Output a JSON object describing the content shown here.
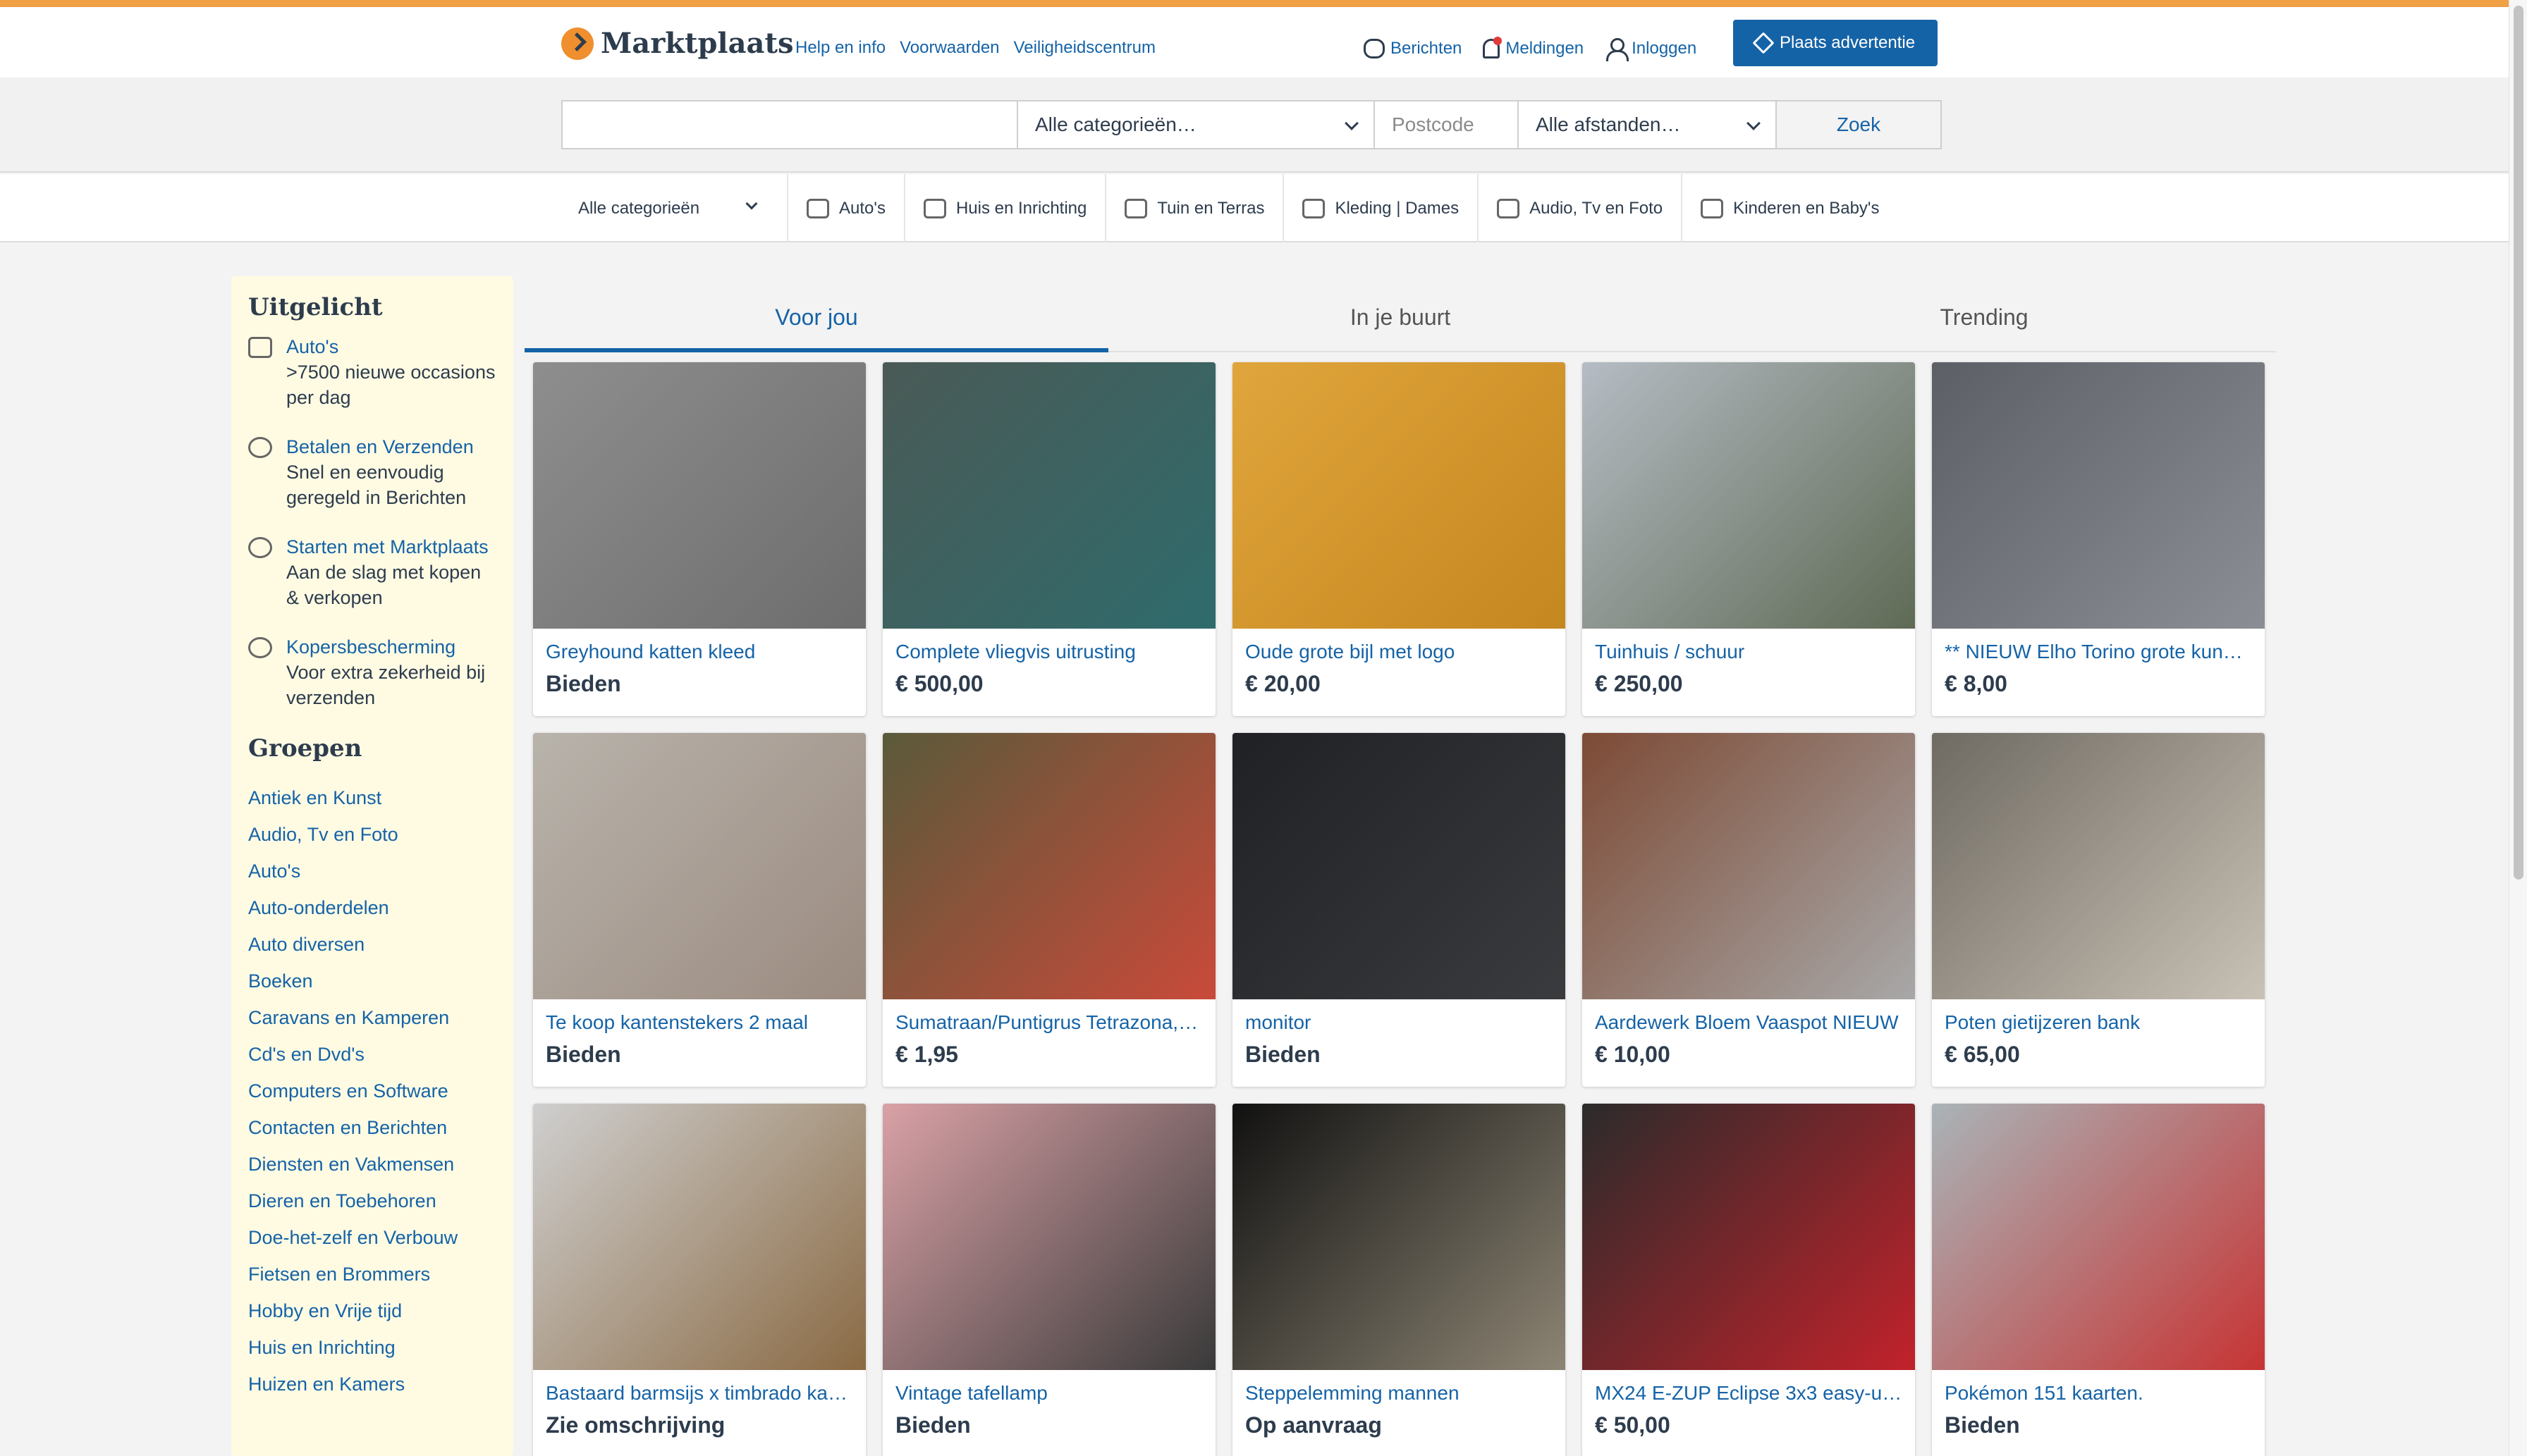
{
  "header": {
    "logo_text": "Marktplaats",
    "nav_links": [
      "Help en info",
      "Voorwaarden",
      "Veiligheidscentrum"
    ],
    "berichten": "Berichten",
    "meldingen": "Meldingen",
    "inloggen": "Inloggen",
    "plaats_advertentie": "Plaats advertentie"
  },
  "search": {
    "query_value": "",
    "category": "Alle categorieën…",
    "postcode_placeholder": "Postcode",
    "distance": "Alle afstanden…",
    "button": "Zoek"
  },
  "categories": [
    {
      "label": "Alle categorieën",
      "icon": "chevron-down-icon"
    },
    {
      "label": "Auto's",
      "icon": "car-icon"
    },
    {
      "label": "Huis en Inrichting",
      "icon": "sofa-icon"
    },
    {
      "label": "Tuin en Terras",
      "icon": "garden-icon"
    },
    {
      "label": "Kleding | Dames",
      "icon": "clothing-icon"
    },
    {
      "label": "Audio, Tv en Foto",
      "icon": "tv-icon"
    },
    {
      "label": "Kinderen en Baby's",
      "icon": "baby-icon"
    }
  ],
  "sidebar": {
    "highlight_heading": "Uitgelicht",
    "highlights": [
      {
        "title": "Auto's",
        "text": ">7500 nieuwe occasions per dag",
        "icon": "car-icon"
      },
      {
        "title": "Betalen en Verzenden",
        "text": "Snel en eenvoudig geregeld in Berichten",
        "icon": "payment-icon"
      },
      {
        "title": "Starten met Marktplaats",
        "text": "Aan de slag met kopen & verkopen",
        "icon": "heart-icon"
      },
      {
        "title": "Kopersbescherming",
        "text": "Voor extra zekerheid bij verzenden",
        "icon": "shield-icon"
      }
    ],
    "groups_heading": "Groepen",
    "groups": [
      "Antiek en Kunst",
      "Audio, Tv en Foto",
      "Auto's",
      "Auto-onderdelen",
      "Auto diversen",
      "Boeken",
      "Caravans en Kamperen",
      "Cd's en Dvd's",
      "Computers en Software",
      "Contacten en Berichten",
      "Diensten en Vakmensen",
      "Dieren en Toebehoren",
      "Doe-het-zelf en Verbouw",
      "Fietsen en Brommers",
      "Hobby en Vrije tijd",
      "Huis en Inrichting",
      "Huizen en Kamers"
    ]
  },
  "tabs": [
    "Voor jou",
    "In je buurt",
    "Trending"
  ],
  "listings": [
    {
      "title": "Greyhound katten kleed",
      "price": "Bieden",
      "colors": [
        "#8e8e8e",
        "#6d6d6d"
      ]
    },
    {
      "title": "Complete vliegvis uitrusting",
      "price": "€ 500,00",
      "colors": [
        "#4a5a56",
        "#2f6b6c"
      ]
    },
    {
      "title": "Oude grote bijl met logo",
      "price": "€ 20,00",
      "colors": [
        "#e0a53c",
        "#c5871f"
      ]
    },
    {
      "title": "Tuinhuis / schuur",
      "price": "€ 250,00",
      "colors": [
        "#b5bcc4",
        "#5f6a55"
      ]
    },
    {
      "title": "** NIEUW Elho Torino grote kunst…",
      "price": "€ 8,00",
      "colors": [
        "#5c6066",
        "#8b8f95"
      ]
    },
    {
      "title": "Te koop kantenstekers 2 maal",
      "price": "Bieden",
      "colors": [
        "#b8b3ab",
        "#9b8b80"
      ]
    },
    {
      "title": "Sumatraan/Puntigrus Tetrazona, …",
      "price": "€ 1,95",
      "colors": [
        "#5a5a3a",
        "#c94a3a"
      ]
    },
    {
      "title": "monitor",
      "price": "Bieden",
      "colors": [
        "#202124",
        "#3a3b3e"
      ]
    },
    {
      "title": "Aardewerk Bloem Vaaspot NIEUW",
      "price": "€ 10,00",
      "colors": [
        "#7d4a35",
        "#a8a8a8"
      ]
    },
    {
      "title": "Poten gietijzeren bank",
      "price": "€ 65,00",
      "colors": [
        "#6f6a62",
        "#c9c2b6"
      ]
    },
    {
      "title": "Bastaard barmsijs x timbrado kan…",
      "price": "Zie omschrijving",
      "colors": [
        "#cfcfcf",
        "#8a6a44"
      ]
    },
    {
      "title": "Vintage tafellamp",
      "price": "Bieden",
      "colors": [
        "#d9a1a6",
        "#3a3a3a"
      ]
    },
    {
      "title": "Steppelemming mannen",
      "price": "Op aanvraag",
      "colors": [
        "#111111",
        "#8d8574"
      ]
    },
    {
      "title": "MX24 E-ZUP Eclipse 3x3 easy-up …",
      "price": "€ 50,00",
      "colors": [
        "#2b2b2b",
        "#c2222b"
      ]
    },
    {
      "title": "Pokémon 151 kaarten.",
      "price": "Bieden",
      "colors": [
        "#a9b4b8",
        "#c73434"
      ]
    }
  ],
  "colors": {
    "accent": "#1563a7",
    "topline": "#f0a045",
    "sidebar_bg": "#fffbe3"
  }
}
